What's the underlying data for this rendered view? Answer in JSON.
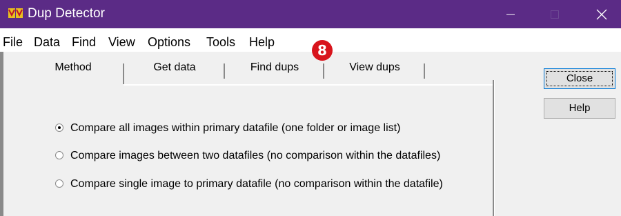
{
  "window": {
    "title": "Dup Detector",
    "controls": {
      "minimize": "—",
      "maximize": "□",
      "close": "✕"
    },
    "colors": {
      "titlebar": "#5b2b86",
      "badge": "#d8141c"
    }
  },
  "menu": [
    "File",
    "Data",
    "Find",
    "View",
    "Options",
    "Tools",
    "Help"
  ],
  "badge": "8",
  "tabs": [
    {
      "label": "Method",
      "selected": true
    },
    {
      "label": "Get data",
      "selected": false
    },
    {
      "label": "Find dups",
      "selected": false
    },
    {
      "label": "View dups",
      "selected": false
    }
  ],
  "buttons": {
    "close": "Close",
    "help": "Help"
  },
  "options": [
    {
      "label": "Compare all images within primary datafile (one folder or image list)",
      "checked": true
    },
    {
      "label": "Compare images between two datafiles (no comparison within the datafiles)",
      "checked": false
    },
    {
      "label": "Compare single image to primary datafile (no comparison within the datafile)",
      "checked": false
    }
  ]
}
